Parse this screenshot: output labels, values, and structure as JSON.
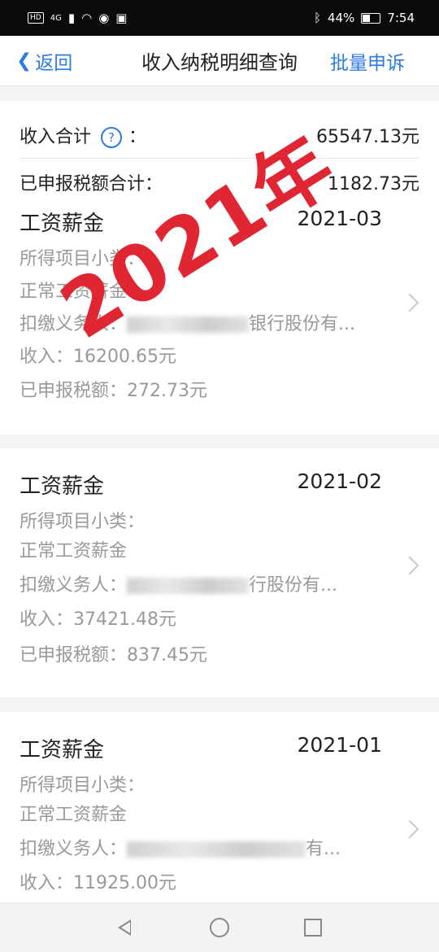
{
  "status": {
    "network": "HD",
    "signal_label": "4G",
    "battery_pct": "44%",
    "time": "7:54"
  },
  "nav": {
    "back_label": "返回",
    "title": "收入纳税明细查询",
    "action_label": "批量申诉"
  },
  "summary": {
    "income_label": "收入合计",
    "income_value": "65547.13元",
    "tax_label": "已申报税额合计：",
    "tax_value": "1182.73元"
  },
  "overlay_text": "2021年",
  "records": [
    {
      "title": "工资薪金",
      "month": "2021-03",
      "subcategory_label": "所得项目小类：",
      "subcategory_value": "正常工资薪金",
      "withholder_label": "扣缴义务人：",
      "withholder_value": "银行股份有...",
      "income": "收入：16200.65元",
      "tax": "已申报税额：272.73元"
    },
    {
      "title": "工资薪金",
      "month": "2021-02",
      "subcategory_label": "所得项目小类：",
      "subcategory_value": "正常工资薪金",
      "withholder_label": "扣缴义务人：",
      "withholder_value": "行股份有...",
      "income": "收入：37421.48元",
      "tax": "已申报税额：837.45元"
    },
    {
      "title": "工资薪金",
      "month": "2021-01",
      "subcategory_label": "所得项目小类：",
      "subcategory_value": "正常工资薪金",
      "withholder_label": "扣缴义务人：",
      "withholder_value": "有...",
      "income": "收入：11925.00元"
    }
  ],
  "icons": {
    "back": "chevron-left-icon",
    "help": "question-circle-icon",
    "more": "chevron-right-icon",
    "nav_back": "triangle-back-icon",
    "nav_home": "circle-home-icon",
    "nav_recent": "square-recent-icon"
  },
  "colors": {
    "accent": "#2c7be5",
    "stamp": "#e02632"
  }
}
